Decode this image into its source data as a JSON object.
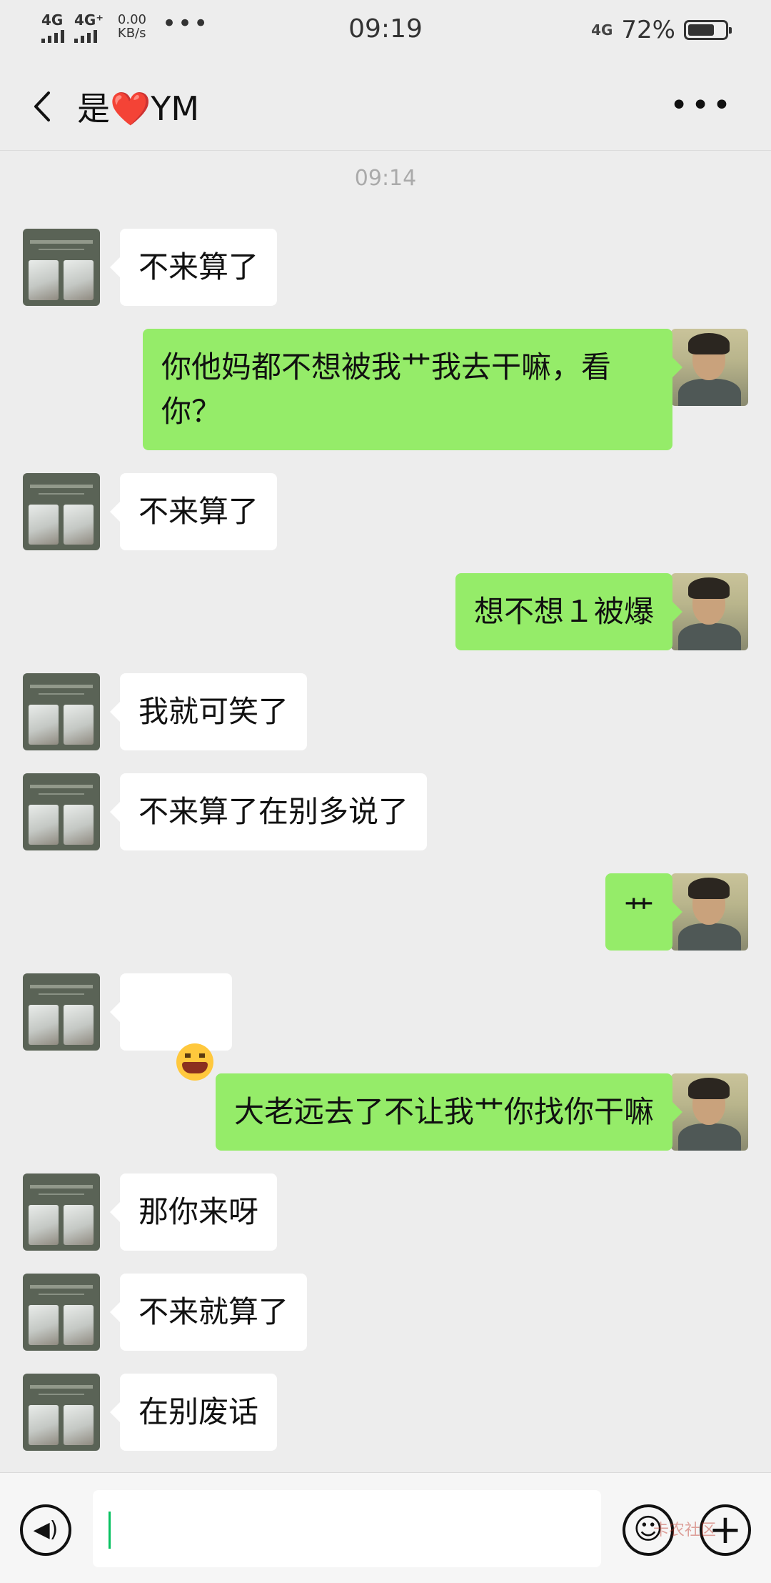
{
  "status_bar": {
    "sim1": "4G",
    "sim2": "4G⁺",
    "speed_value": "0.00",
    "speed_unit": "KB/s",
    "time": "09:19",
    "network": "4G",
    "battery": "72%",
    "battery_level": 0.72
  },
  "header": {
    "title": "是❤️YM",
    "back_icon": "chevron-left-icon",
    "more_icon": "more-horizontal-icon"
  },
  "chat": {
    "time_divider": "09:14",
    "messages": [
      {
        "side": "left",
        "text": "不来算了"
      },
      {
        "side": "right",
        "text": "你他妈都不想被我艹我去干嘛，看你？"
      },
      {
        "side": "left",
        "text": "不来算了"
      },
      {
        "side": "right",
        "text": "想不想１被爆"
      },
      {
        "side": "left",
        "text": "我就可笑了"
      },
      {
        "side": "left",
        "text": "不来算了在别多说了"
      },
      {
        "side": "right",
        "text": "艹"
      },
      {
        "side": "left",
        "emoji": "tired-face-emoji"
      },
      {
        "side": "right",
        "text": "大老远去了不让我艹你找你干嘛"
      },
      {
        "side": "left",
        "text": "那你来呀"
      },
      {
        "side": "left",
        "text": "不来就算了"
      },
      {
        "side": "left",
        "text": "在别废话"
      }
    ]
  },
  "input_bar": {
    "voice_icon": "voice-icon",
    "emoji_icon": "emoji-icon",
    "plus_icon": "plus-icon",
    "watermark": "卡农社区"
  }
}
